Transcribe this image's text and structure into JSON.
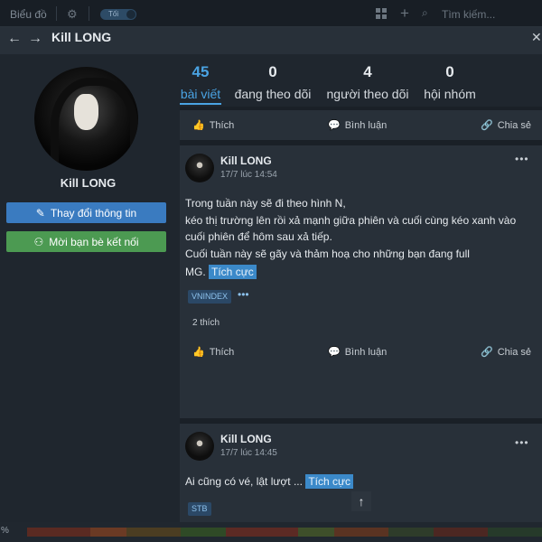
{
  "topbar": {
    "title": "Biểu đồ",
    "gear_icon": "gear-icon",
    "toggle_label": "Tối",
    "search_placeholder": "Tìm kiếm..."
  },
  "header": {
    "title": "Kill LONG"
  },
  "profile": {
    "name": "Kill LONG",
    "edit_button": "Thay đổi thông tin",
    "add_friend_button": "Mời bạn bè kết nối"
  },
  "stats": [
    {
      "num": "45",
      "label": "bài viết"
    },
    {
      "num": "0",
      "label": "đang theo dõi"
    },
    {
      "num": "4",
      "label": "người theo dõi"
    },
    {
      "num": "0",
      "label": "hội nhóm"
    }
  ],
  "actions": {
    "like": "Thích",
    "comment": "Bình luận",
    "share": "Chia sẻ"
  },
  "posts": [
    {
      "author": "Kill LONG",
      "time": "17/7 lúc 14:54",
      "lines": [
        "Trong tuần này sẽ đi theo hình N,",
        "kéo thị trường lên rồi xả mạnh giữa phiên và cuối cùng kéo xanh vào",
        "cuối phiên để hôm sau xả tiếp.",
        "Cuối tuần này sẽ gãy và thảm hoạ cho những bạn đang full",
        "MG."
      ],
      "sentiment": "Tích cực",
      "tag": "VNINDEX",
      "likes": "2 thích"
    },
    {
      "author": "Kill LONG",
      "time": "17/7 lúc 14:45",
      "lines": [
        "Ai cũng có vé, lật lượt ..."
      ],
      "sentiment": "Tích cực",
      "tag": "STB"
    }
  ],
  "bottom": {
    "pct": "%"
  },
  "colors": {
    "accent": "#4aa3e3",
    "edit_button": "#3a7bc0",
    "add_button": "#4c9a52",
    "highlight": "#3b89c9"
  }
}
